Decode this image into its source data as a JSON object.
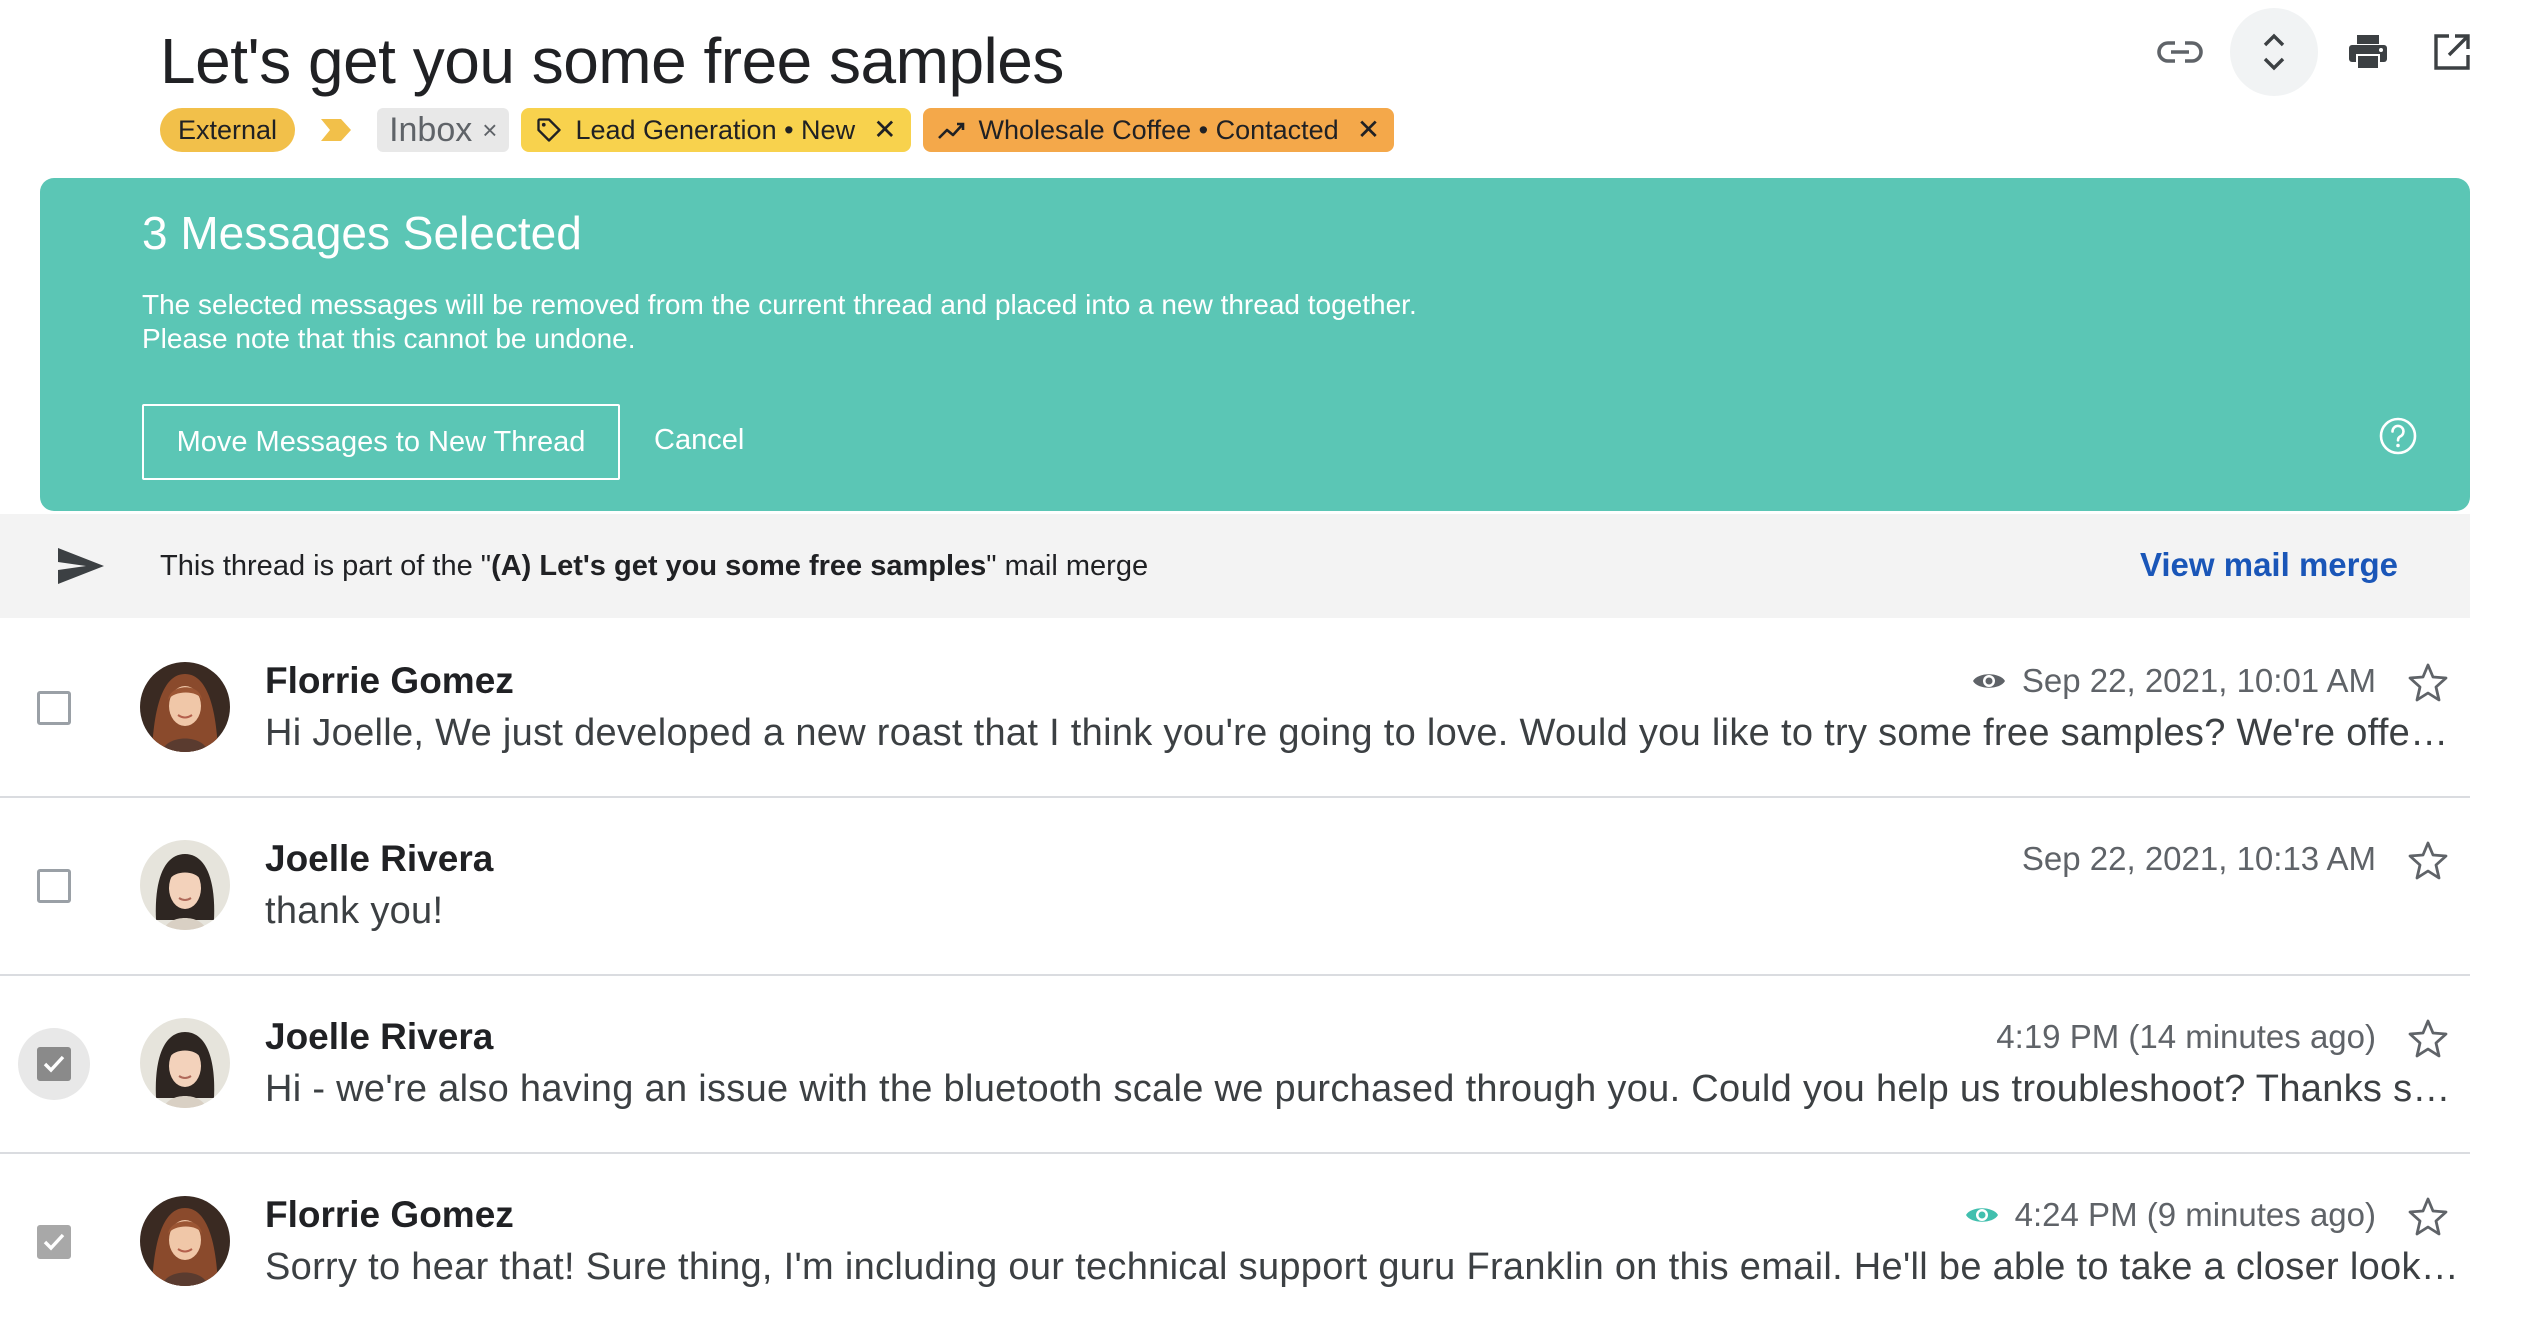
{
  "header": {
    "subject": "Let's get you some free samples",
    "labels": {
      "external": "External",
      "inbox": "Inbox",
      "lead": "Lead Generation • New",
      "coffee": "Wholesale Coffee • Contacted",
      "remove_glyph": "×",
      "remove_glyph_tag": "✕"
    },
    "colors": {
      "external": "#f2c04a",
      "lead": "#f8d24d",
      "coffee": "#f4a84a"
    }
  },
  "banner": {
    "title": "3 Messages Selected",
    "line1": "The selected messages will be removed from the current thread and placed into a new thread together.",
    "line2": "Please note that this cannot be undone.",
    "primary_button": "Move Messages to New Thread",
    "cancel": "Cancel",
    "color": "#5bc6b5"
  },
  "merge": {
    "prefix": "This thread is part of the \"",
    "name": "(A) Let's get you some free samples",
    "suffix": "\" mail merge",
    "link": "View mail merge",
    "link_color": "#1a56b8"
  },
  "messages": [
    {
      "sender": "Florrie Gomez",
      "time": "Sep 22, 2021, 10:01 AM",
      "snippet": "Hi Joelle, We just developed a new roast that I think you're going to love. Would you like to try some free samples? We're offering them to our top customers this month.",
      "checked": false,
      "opened_indicator": "gray"
    },
    {
      "sender": "Joelle Rivera",
      "time": "Sep 22, 2021, 10:13 AM",
      "snippet": "thank you!",
      "checked": false,
      "opened_indicator": "none"
    },
    {
      "sender": "Joelle Rivera",
      "time": "4:19 PM (14 minutes ago)",
      "snippet": "Hi - we're also having an issue with the bluetooth scale we purchased through you. Could you help us troubleshoot? Thanks so much for your help.",
      "checked": true,
      "opened_indicator": "none"
    },
    {
      "sender": "Florrie Gomez",
      "time": "4:24 PM (9 minutes ago)",
      "snippet": "Sorry to hear that! Sure thing, I'm including our technical support guru Franklin on this email. He'll be able to take a closer look at the scale issue.",
      "checked": true,
      "opened_indicator": "teal"
    }
  ],
  "icons": [
    "link-icon",
    "expand-collapse-icon",
    "print-icon",
    "open-in-new-window-icon",
    "help-icon",
    "send-icon",
    "eye-icon",
    "star-icon",
    "tag-icon",
    "trending-up-icon",
    "importance-marker-icon"
  ]
}
